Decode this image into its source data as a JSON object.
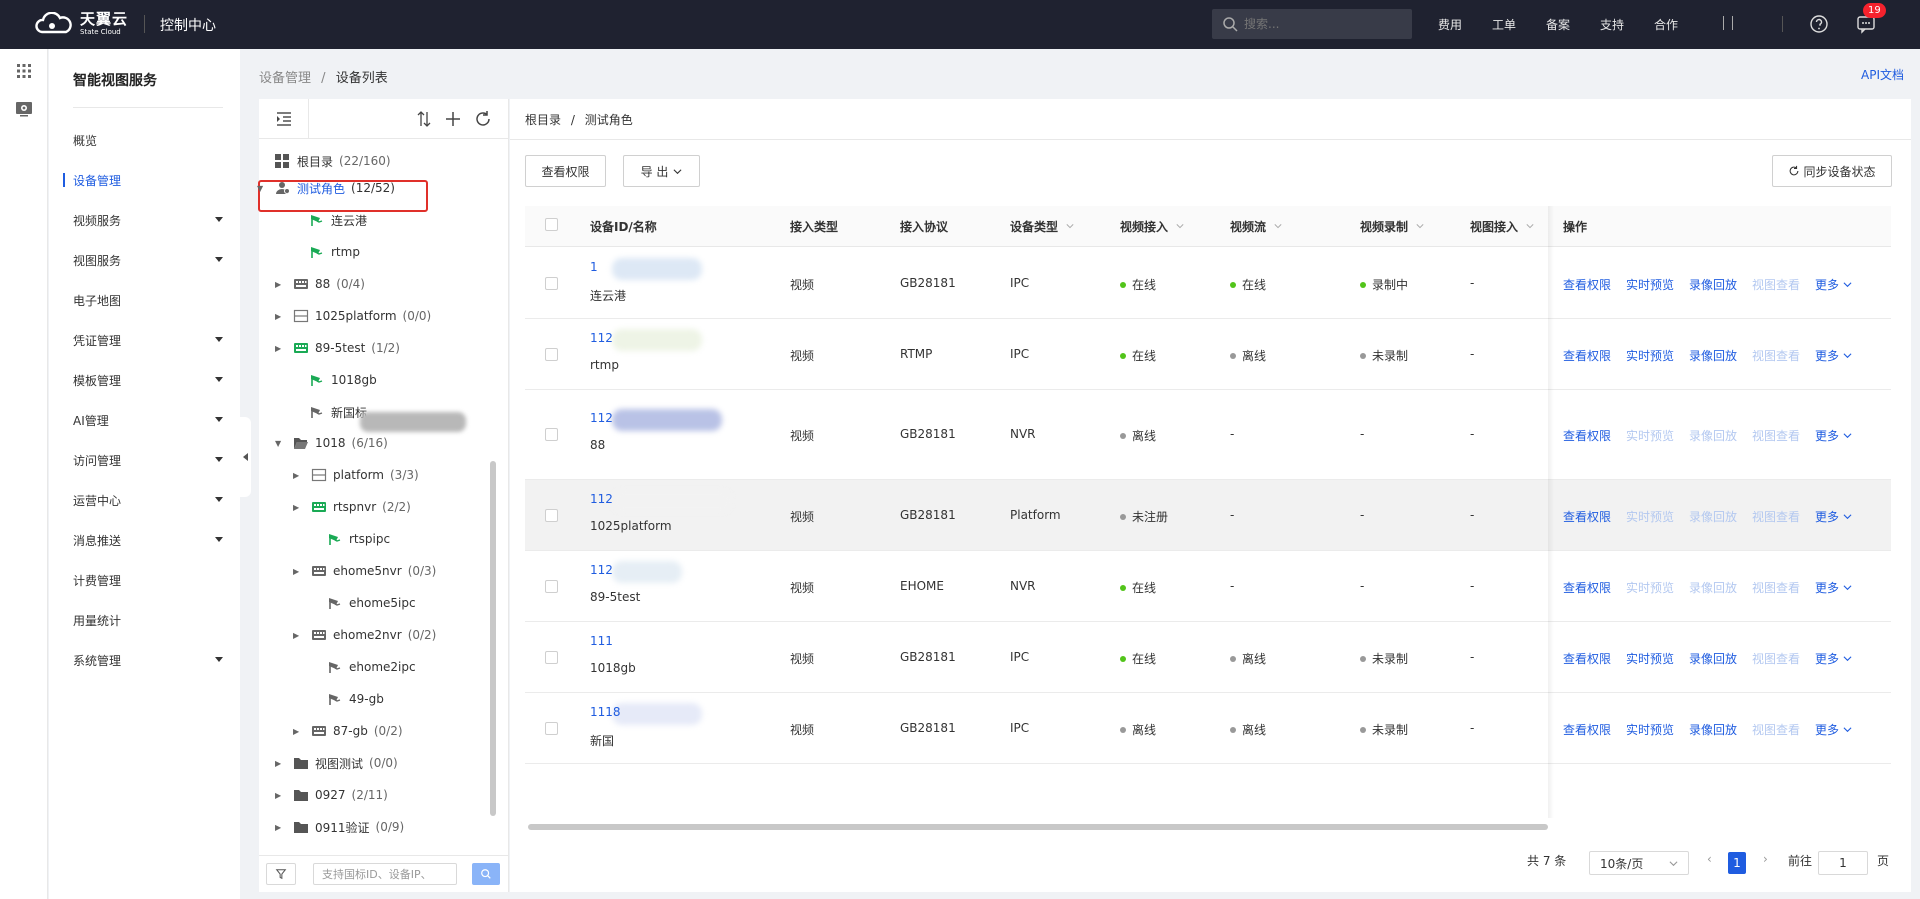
{
  "topbar": {
    "logo_cn": "天翼云",
    "logo_en": "State Cloud",
    "console": "控制中心",
    "search_placeholder": "搜索...",
    "nav": [
      "费用",
      "工单",
      "备案",
      "支持",
      "合作"
    ],
    "badge": "19"
  },
  "sidebar": {
    "title": "智能视图服务",
    "items": [
      {
        "label": "概览"
      },
      {
        "label": "设备管理"
      },
      {
        "label": "视频服务"
      },
      {
        "label": "视图服务"
      },
      {
        "label": "电子地图"
      },
      {
        "label": "凭证管理"
      },
      {
        "label": "模板管理"
      },
      {
        "label": "AI管理"
      },
      {
        "label": "访问管理"
      },
      {
        "label": "运营中心"
      },
      {
        "label": "消息推送"
      },
      {
        "label": "计费管理"
      },
      {
        "label": "用量统计"
      },
      {
        "label": "系统管理"
      }
    ]
  },
  "breadcrumb": {
    "parent": "设备管理",
    "sep": "/",
    "current": "设备列表"
  },
  "api_doc": "API文档",
  "tree": {
    "root": {
      "label": "根目录",
      "count": "(22/160)"
    },
    "nodes": [
      {
        "label": "测试角色",
        "count": "(12/52)"
      },
      {
        "label": "连云港",
        "count": ""
      },
      {
        "label": "rtmp",
        "count": ""
      },
      {
        "label": "88",
        "count": "(0/4)"
      },
      {
        "label": "1025platform",
        "count": "(0/0)"
      },
      {
        "label": "89-5test",
        "count": "(1/2)"
      },
      {
        "label": "1018gb",
        "count": ""
      },
      {
        "label": "新国标",
        "count": ""
      },
      {
        "label": "1018",
        "count": "(6/16)"
      },
      {
        "label": "platform",
        "count": "(3/3)"
      },
      {
        "label": "rtspnvr",
        "count": "(2/2)"
      },
      {
        "label": "rtspipc",
        "count": ""
      },
      {
        "label": "ehome5nvr",
        "count": "(0/3)"
      },
      {
        "label": "ehome5ipc",
        "count": ""
      },
      {
        "label": "ehome2nvr",
        "count": "(0/2)"
      },
      {
        "label": "ehome2ipc",
        "count": ""
      },
      {
        "label": "49-gb",
        "count": ""
      },
      {
        "label": "87-gb",
        "count": "(0/2)"
      },
      {
        "label": "视图测试",
        "count": "(0/0)"
      },
      {
        "label": "0927",
        "count": "(2/11)"
      },
      {
        "label": "0911验证",
        "count": "(0/9)"
      }
    ],
    "search_placeholder": "支持国标ID、设备IP、"
  },
  "main": {
    "breadcrumb": {
      "root": "根目录",
      "sep": "/",
      "current": "测试角色"
    },
    "btn_view_perm": "查看权限",
    "btn_export": "导 出",
    "btn_sync": "同步设备状态",
    "columns": [
      "设备ID/名称",
      "接入类型",
      "接入协议",
      "设备类型",
      "视频接入",
      "视频流",
      "视频录制",
      "视图接入",
      "操作"
    ],
    "rows": [
      {
        "id": "1",
        "name": "连云港",
        "type": "视频",
        "protocol": "GB28181",
        "dev": "IPC",
        "video": "在线",
        "stream": "在线",
        "record": "录制中",
        "view": "-"
      },
      {
        "id": "112",
        "name": "rtmp",
        "type": "视频",
        "protocol": "RTMP",
        "dev": "IPC",
        "video": "在线",
        "stream": "离线",
        "record": "未录制",
        "view": "-"
      },
      {
        "id": "112",
        "name": "88",
        "type": "视频",
        "protocol": "GB28181",
        "dev": "NVR",
        "video": "离线",
        "stream": "-",
        "record": "-",
        "view": "-"
      },
      {
        "id": "112",
        "name": "1025platform",
        "type": "视频",
        "protocol": "GB28181",
        "dev": "Platform",
        "video": "未注册",
        "stream": "-",
        "record": "-",
        "view": "-"
      },
      {
        "id": "112",
        "name": "89-5test",
        "type": "视频",
        "protocol": "EHOME",
        "dev": "NVR",
        "video": "在线",
        "stream": "-",
        "record": "-",
        "view": "-"
      },
      {
        "id": "111",
        "name": "1018gb",
        "type": "视频",
        "protocol": "GB28181",
        "dev": "IPC",
        "video": "在线",
        "stream": "离线",
        "record": "未录制",
        "view": "-"
      },
      {
        "id": "1118",
        "name": "新国",
        "type": "视频",
        "protocol": "GB28181",
        "dev": "IPC",
        "video": "离线",
        "stream": "离线",
        "record": "未录制",
        "view": "-"
      }
    ],
    "ops": [
      "查看权限",
      "实时预览",
      "录像回放",
      "视图查看",
      "更多"
    ],
    "pager": {
      "total": "共 7 条",
      "size": "10条/页",
      "page": "1",
      "goto": "前往",
      "goto_val": "1",
      "unit": "页"
    }
  }
}
